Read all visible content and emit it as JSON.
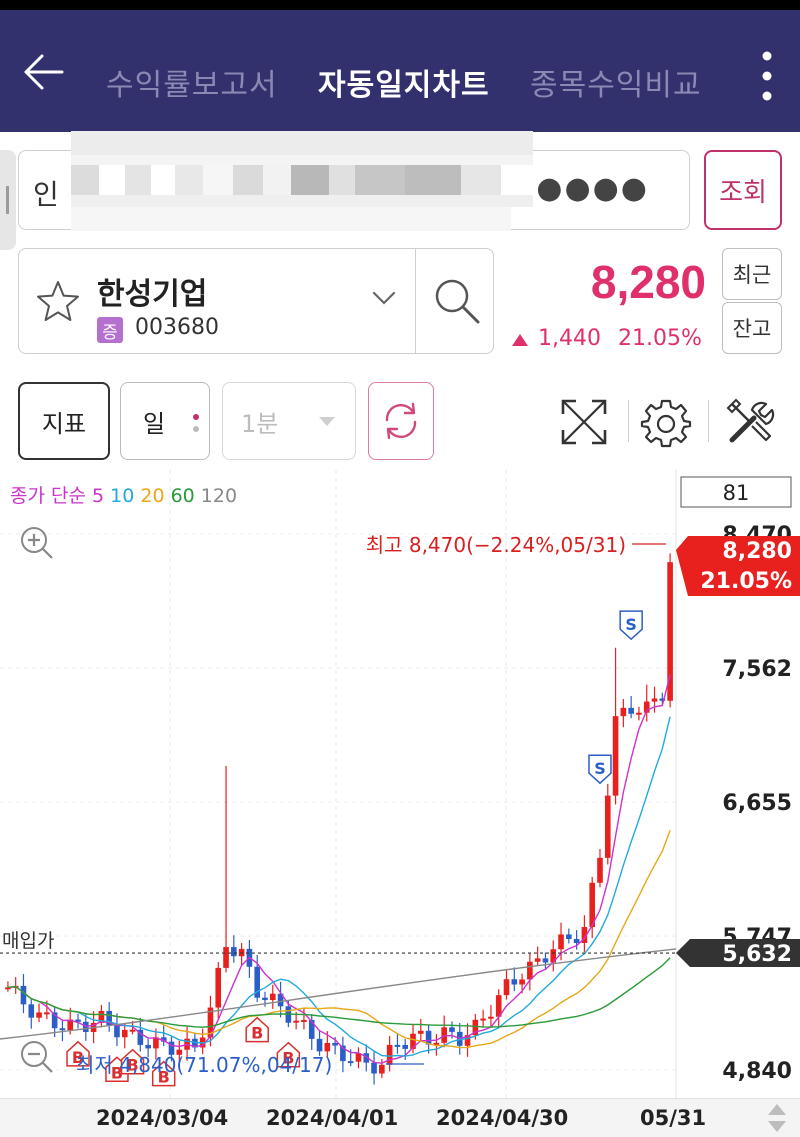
{
  "header": {
    "tabs": [
      {
        "label": "수익률보고서"
      },
      {
        "label": "자동일지차트"
      },
      {
        "label": "종목수익비교"
      }
    ]
  },
  "account": {
    "prefix": "인",
    "password_mask": "●●●●",
    "query_label": "조회"
  },
  "stock": {
    "name": "한성기업",
    "market_badge": "증",
    "code": "003680",
    "price": "8,280",
    "change": "1,440",
    "change_pct": "21.05%",
    "recent_label": "최근",
    "balance_label": "잔고"
  },
  "toolbar": {
    "indicator_label": "지표",
    "period_label": "일",
    "interval_label": "1분"
  },
  "chart_data": {
    "type": "candlestick",
    "ma_legend": {
      "prefix": "종가 단순",
      "periods": [
        "5",
        "10",
        "20",
        "60",
        "120"
      ]
    },
    "ma_colors": [
      "#cc33cc",
      "#22aadd",
      "#e6a817",
      "#2a9a3a",
      "#888888"
    ],
    "up_color": "#e8201e",
    "down_color": "#2b5fc7",
    "info_box": "81",
    "y_ticks": [
      "8,470",
      "7,562",
      "6,655",
      "5,747",
      "4,840"
    ],
    "y_tick_values": [
      8470,
      7562,
      6655,
      5747,
      4840
    ],
    "ylim": [
      4840,
      8470
    ],
    "high_annotation": "최고 8,470(−2.24%,05/31)",
    "low_annotation": "최저 4,840(71.07%,04/17)",
    "current_price": "8,280",
    "current_pct": "21.05%",
    "avg_price_label": "매입가",
    "avg_price": "5,632",
    "avg_price_value": 5632,
    "x_labels": [
      "2024/03/04",
      "2024/04/01",
      "2024/04/30",
      "05/31"
    ],
    "buy_markers": [
      {
        "label": "B",
        "i": 9
      },
      {
        "label": "B",
        "i": 14
      },
      {
        "label": "B",
        "i": 16
      },
      {
        "label": "B",
        "i": 20
      },
      {
        "label": "B",
        "i": 32
      },
      {
        "label": "B",
        "i": 36
      }
    ],
    "sell_markers": [
      {
        "label": "S",
        "i": 76
      },
      {
        "label": "S",
        "i": 80
      }
    ]
  }
}
